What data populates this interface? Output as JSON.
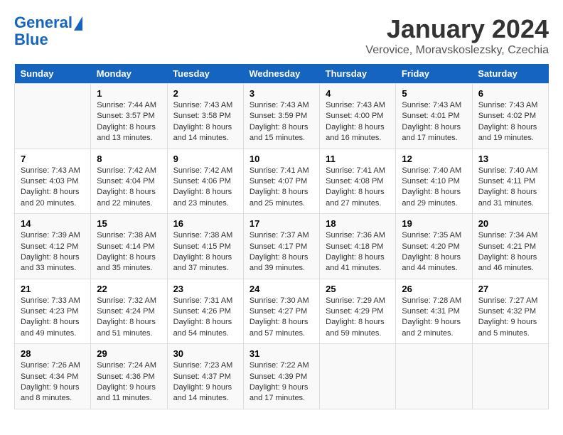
{
  "header": {
    "logo_line1": "General",
    "logo_line2": "Blue",
    "title": "January 2024",
    "subtitle": "Verovice, Moravskoslezsky, Czechia"
  },
  "days_of_week": [
    "Sunday",
    "Monday",
    "Tuesday",
    "Wednesday",
    "Thursday",
    "Friday",
    "Saturday"
  ],
  "weeks": [
    [
      {
        "day": "",
        "info": ""
      },
      {
        "day": "1",
        "info": "Sunrise: 7:44 AM\nSunset: 3:57 PM\nDaylight: 8 hours\nand 13 minutes."
      },
      {
        "day": "2",
        "info": "Sunrise: 7:43 AM\nSunset: 3:58 PM\nDaylight: 8 hours\nand 14 minutes."
      },
      {
        "day": "3",
        "info": "Sunrise: 7:43 AM\nSunset: 3:59 PM\nDaylight: 8 hours\nand 15 minutes."
      },
      {
        "day": "4",
        "info": "Sunrise: 7:43 AM\nSunset: 4:00 PM\nDaylight: 8 hours\nand 16 minutes."
      },
      {
        "day": "5",
        "info": "Sunrise: 7:43 AM\nSunset: 4:01 PM\nDaylight: 8 hours\nand 17 minutes."
      },
      {
        "day": "6",
        "info": "Sunrise: 7:43 AM\nSunset: 4:02 PM\nDaylight: 8 hours\nand 19 minutes."
      }
    ],
    [
      {
        "day": "7",
        "info": "Sunrise: 7:43 AM\nSunset: 4:03 PM\nDaylight: 8 hours\nand 20 minutes."
      },
      {
        "day": "8",
        "info": "Sunrise: 7:42 AM\nSunset: 4:04 PM\nDaylight: 8 hours\nand 22 minutes."
      },
      {
        "day": "9",
        "info": "Sunrise: 7:42 AM\nSunset: 4:06 PM\nDaylight: 8 hours\nand 23 minutes."
      },
      {
        "day": "10",
        "info": "Sunrise: 7:41 AM\nSunset: 4:07 PM\nDaylight: 8 hours\nand 25 minutes."
      },
      {
        "day": "11",
        "info": "Sunrise: 7:41 AM\nSunset: 4:08 PM\nDaylight: 8 hours\nand 27 minutes."
      },
      {
        "day": "12",
        "info": "Sunrise: 7:40 AM\nSunset: 4:10 PM\nDaylight: 8 hours\nand 29 minutes."
      },
      {
        "day": "13",
        "info": "Sunrise: 7:40 AM\nSunset: 4:11 PM\nDaylight: 8 hours\nand 31 minutes."
      }
    ],
    [
      {
        "day": "14",
        "info": "Sunrise: 7:39 AM\nSunset: 4:12 PM\nDaylight: 8 hours\nand 33 minutes."
      },
      {
        "day": "15",
        "info": "Sunrise: 7:38 AM\nSunset: 4:14 PM\nDaylight: 8 hours\nand 35 minutes."
      },
      {
        "day": "16",
        "info": "Sunrise: 7:38 AM\nSunset: 4:15 PM\nDaylight: 8 hours\nand 37 minutes."
      },
      {
        "day": "17",
        "info": "Sunrise: 7:37 AM\nSunset: 4:17 PM\nDaylight: 8 hours\nand 39 minutes."
      },
      {
        "day": "18",
        "info": "Sunrise: 7:36 AM\nSunset: 4:18 PM\nDaylight: 8 hours\nand 41 minutes."
      },
      {
        "day": "19",
        "info": "Sunrise: 7:35 AM\nSunset: 4:20 PM\nDaylight: 8 hours\nand 44 minutes."
      },
      {
        "day": "20",
        "info": "Sunrise: 7:34 AM\nSunset: 4:21 PM\nDaylight: 8 hours\nand 46 minutes."
      }
    ],
    [
      {
        "day": "21",
        "info": "Sunrise: 7:33 AM\nSunset: 4:23 PM\nDaylight: 8 hours\nand 49 minutes."
      },
      {
        "day": "22",
        "info": "Sunrise: 7:32 AM\nSunset: 4:24 PM\nDaylight: 8 hours\nand 51 minutes."
      },
      {
        "day": "23",
        "info": "Sunrise: 7:31 AM\nSunset: 4:26 PM\nDaylight: 8 hours\nand 54 minutes."
      },
      {
        "day": "24",
        "info": "Sunrise: 7:30 AM\nSunset: 4:27 PM\nDaylight: 8 hours\nand 57 minutes."
      },
      {
        "day": "25",
        "info": "Sunrise: 7:29 AM\nSunset: 4:29 PM\nDaylight: 8 hours\nand 59 minutes."
      },
      {
        "day": "26",
        "info": "Sunrise: 7:28 AM\nSunset: 4:31 PM\nDaylight: 9 hours\nand 2 minutes."
      },
      {
        "day": "27",
        "info": "Sunrise: 7:27 AM\nSunset: 4:32 PM\nDaylight: 9 hours\nand 5 minutes."
      }
    ],
    [
      {
        "day": "28",
        "info": "Sunrise: 7:26 AM\nSunset: 4:34 PM\nDaylight: 9 hours\nand 8 minutes."
      },
      {
        "day": "29",
        "info": "Sunrise: 7:24 AM\nSunset: 4:36 PM\nDaylight: 9 hours\nand 11 minutes."
      },
      {
        "day": "30",
        "info": "Sunrise: 7:23 AM\nSunset: 4:37 PM\nDaylight: 9 hours\nand 14 minutes."
      },
      {
        "day": "31",
        "info": "Sunrise: 7:22 AM\nSunset: 4:39 PM\nDaylight: 9 hours\nand 17 minutes."
      },
      {
        "day": "",
        "info": ""
      },
      {
        "day": "",
        "info": ""
      },
      {
        "day": "",
        "info": ""
      }
    ]
  ]
}
